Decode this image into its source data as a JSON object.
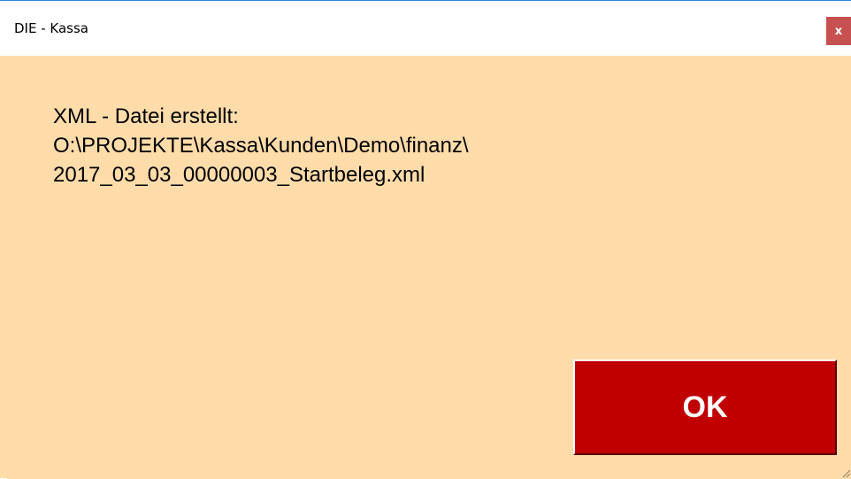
{
  "window": {
    "title": "DIE - Kassa",
    "close_label": "x"
  },
  "message": {
    "line1": "XML - Datei erstellt:",
    "line2": "O:\\PROJEKTE\\Kassa\\Kunden\\Demo\\finanz\\",
    "line3": "2017_03_03_00000003_Startbeleg.xml"
  },
  "buttons": {
    "ok_label": "OK"
  },
  "colors": {
    "background": "#ffdcaa",
    "ok_button": "#c00000",
    "close_button": "#c75050",
    "title_border": "#2b87d8"
  }
}
